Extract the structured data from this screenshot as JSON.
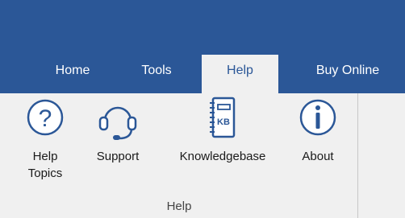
{
  "tabs": [
    {
      "label": "Home"
    },
    {
      "label": "Tools"
    },
    {
      "label": "Help",
      "active": true
    },
    {
      "label": "Buy Online"
    }
  ],
  "ribbon": {
    "buttons": [
      {
        "icon": "question-circle-icon",
        "label_line1": "Help",
        "label_line2": "Topics"
      },
      {
        "icon": "headset-icon",
        "label": "Support"
      },
      {
        "icon": "knowledgebase-icon",
        "label": "Knowledgebase",
        "icon_text": "KB"
      },
      {
        "icon": "info-circle-icon",
        "label": "About"
      }
    ],
    "group_label": "Help"
  },
  "colors": {
    "title_bar": "#2b5797",
    "ribbon": "#f0f0f0",
    "icon": "#2b5797"
  }
}
